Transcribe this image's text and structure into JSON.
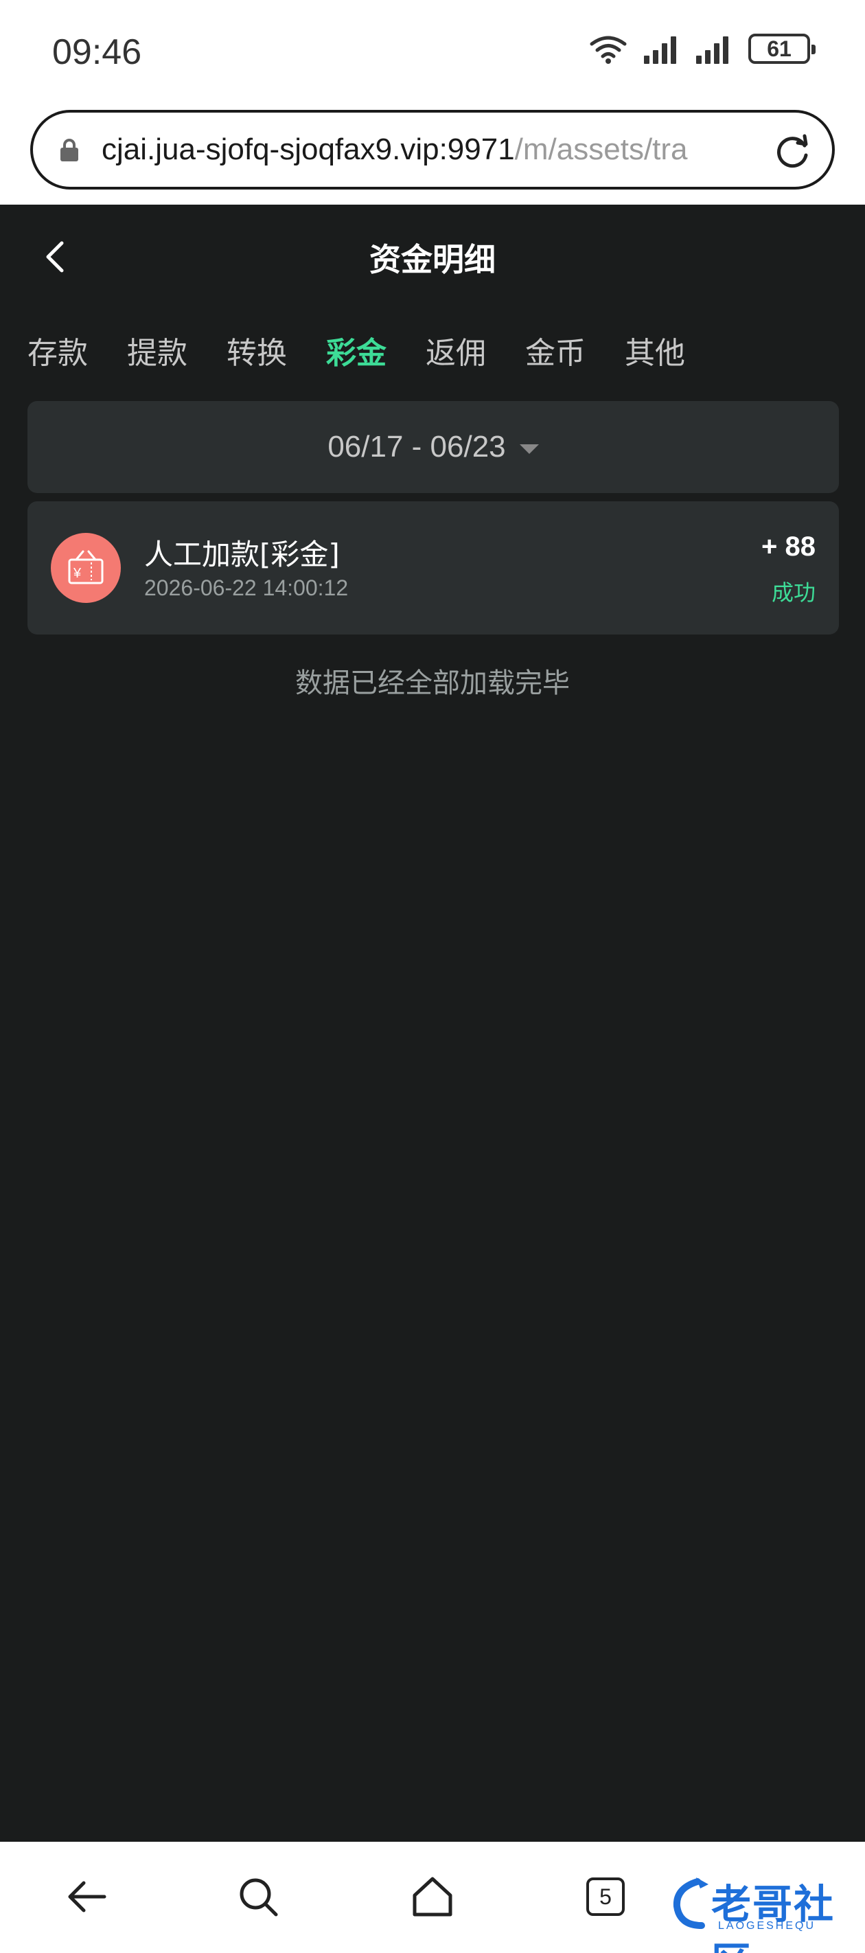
{
  "status_bar": {
    "time": "09:46",
    "battery": "61",
    "wifi_icon": "wifi-icon",
    "signal_icon": "signal-icon"
  },
  "browser": {
    "url_host": "cjai.jua-sjofq-sjoqfax9.vip:9971",
    "url_path": "/m/assets/tra",
    "lock_icon": "lock-icon",
    "reload_icon": "reload-icon"
  },
  "header": {
    "title": "资金明细",
    "back_icon": "chevron-left-icon"
  },
  "tabs": [
    {
      "label": "存款",
      "active": false
    },
    {
      "label": "提款",
      "active": false
    },
    {
      "label": "转换",
      "active": false
    },
    {
      "label": "彩金",
      "active": true
    },
    {
      "label": "返佣",
      "active": false
    },
    {
      "label": "金币",
      "active": false
    },
    {
      "label": "其他",
      "active": false
    }
  ],
  "date_filter": {
    "range": "06/17 - 06/23"
  },
  "records": [
    {
      "title": "人工加款[彩金]",
      "time": "2026-06-22 14:00:12",
      "amount": "+ 88",
      "status": "成功",
      "icon": "gift-icon"
    }
  ],
  "list_end_text": "数据已经全部加载完毕",
  "bottom_nav": {
    "tab_count": "5",
    "watermark_text": "老哥社区",
    "watermark_sub": "LAOGESHEQU"
  },
  "colors": {
    "accent": "#3ddc97",
    "background": "#1a1c1c",
    "card": "#2b2f30",
    "record_icon_bg": "#f47a72"
  }
}
